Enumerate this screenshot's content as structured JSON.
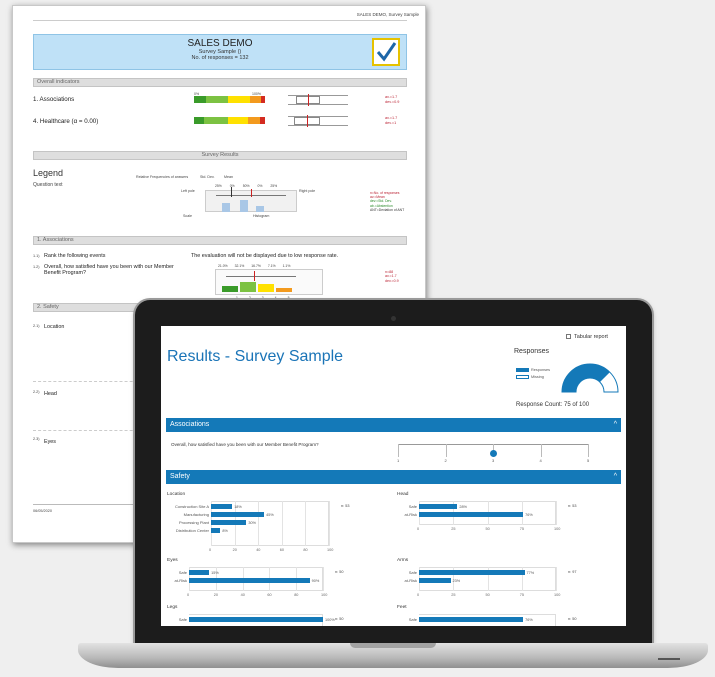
{
  "report": {
    "top_right": "SALES DEMO, Survey Sample",
    "title": "SALES DEMO",
    "subtitle": "Survey Sample ()",
    "responses": "No. of responses = 132",
    "sections": {
      "overall": "Overall indicators",
      "survey_results": "Survey Results",
      "associations": "1. Associations",
      "safety": "2. Safety"
    },
    "indicators": [
      {
        "label": "1. Associations",
        "ann1": "av.=1.7",
        "ann2": "dev.=0.9"
      },
      {
        "label": "4. Healthcare (α = 0.00)",
        "ann1": "av.=1.7",
        "ann2": "dev.=1"
      }
    ],
    "legend": {
      "title": "Legend",
      "question_text": "Question text",
      "rel_freq": "Relative Frequencies of answers",
      "std_dev": "Std. Dev.",
      "mean": "Mean",
      "left_pole": "Left pole",
      "right_pole": "Right pole",
      "scale_label": "Scale",
      "histogram": "Histogram",
      "pct_labels": [
        "25%",
        "0%",
        "50%",
        "0%",
        "25%"
      ],
      "side": [
        "n=No. of responses",
        "av.=Mean",
        "dev.=Std. Dev.",
        "ab.=Abstention",
        "ANT=Deviation of ANT"
      ]
    },
    "q_rank": "Rank the following events",
    "q_rank_num": "1.1)",
    "q_rank_note": "The evaluation will not be displayed due to low response rate.",
    "q_overall_num": "1.2)",
    "q_overall": "Overall, how satisfied have you been with our Member Benefit Program?",
    "q_overall_pcts": [
      "21.0%",
      "32.1%",
      "16.7%",
      "7.1%",
      "1.1%"
    ],
    "q_overall_ann": [
      "n=88",
      "av.=1.7",
      "dev.=0.9"
    ],
    "safety_items": [
      {
        "num": "2.1)",
        "label": "Location"
      },
      {
        "num": "2.2)",
        "label": "Head"
      },
      {
        "num": "2.3)",
        "label": "Eyes"
      }
    ],
    "footer_date": "06/05/2020"
  },
  "screen": {
    "title": "Results - Survey Sample",
    "tabular_report": "Tabular report",
    "responses_title": "Responses",
    "legend": [
      {
        "label": "Responses",
        "color": "#1479b8"
      },
      {
        "label": "Missing",
        "color": "#ffffff"
      }
    ],
    "gauge_fraction": 0.75,
    "response_count": "Response Count: 75 of 100",
    "sections": [
      {
        "label": "Associations",
        "chevron": "^"
      },
      {
        "label": "Safety",
        "chevron": "^"
      }
    ],
    "question": "Overall, how satisfied have you been with our Member Benefit Program?",
    "scale": {
      "ticks": [
        "1",
        "2",
        "3",
        "4",
        "5"
      ],
      "mean": 3
    },
    "chart_data": [
      {
        "type": "bar",
        "title": "Location",
        "n": "n: 53",
        "categories": [
          "Construction Site A",
          "Manufacturing",
          "Processing Plant",
          "Distribution Center"
        ],
        "values": [
          18,
          45,
          30,
          8
        ],
        "value_labels": [
          "18%",
          "45%",
          "30%",
          "8%"
        ],
        "ticks": [
          "0",
          "20",
          "40",
          "60",
          "80",
          "100"
        ],
        "xlim": [
          0,
          100
        ]
      },
      {
        "type": "bar",
        "title": "Head",
        "n": "n: 53",
        "categories": [
          "Safe",
          "at-Risk"
        ],
        "values": [
          28,
          76
        ],
        "value_labels": [
          "28%",
          "76%"
        ],
        "ticks": [
          "0",
          "25",
          "50",
          "75",
          "100"
        ],
        "xlim": [
          0,
          100
        ]
      },
      {
        "type": "bar",
        "title": "Eyes",
        "n": "n: 50",
        "categories": [
          "Safe",
          "at-Risk"
        ],
        "values": [
          15,
          90
        ],
        "value_labels": [
          "15%",
          "90%"
        ],
        "ticks": [
          "0",
          "20",
          "40",
          "60",
          "80",
          "100"
        ],
        "xlim": [
          0,
          100
        ]
      },
      {
        "type": "bar",
        "title": "Arms",
        "n": "n: 97",
        "categories": [
          "Safe",
          "at-Risk"
        ],
        "values": [
          77,
          23
        ],
        "value_labels": [
          "77%",
          "23%"
        ],
        "ticks": [
          "0",
          "25",
          "50",
          "75",
          "100"
        ],
        "xlim": [
          0,
          100
        ]
      },
      {
        "type": "bar",
        "title": "Legs",
        "n": "n: 50",
        "categories": [
          "Safe"
        ],
        "values": [
          100
        ],
        "value_labels": [
          "100%"
        ],
        "ticks": [],
        "xlim": [
          0,
          100
        ]
      },
      {
        "type": "bar",
        "title": "Feet",
        "n": "n: 50",
        "categories": [
          "Safe"
        ],
        "values": [
          76
        ],
        "value_labels": [
          "76%"
        ],
        "ticks": [],
        "xlim": [
          0,
          100
        ]
      }
    ]
  }
}
